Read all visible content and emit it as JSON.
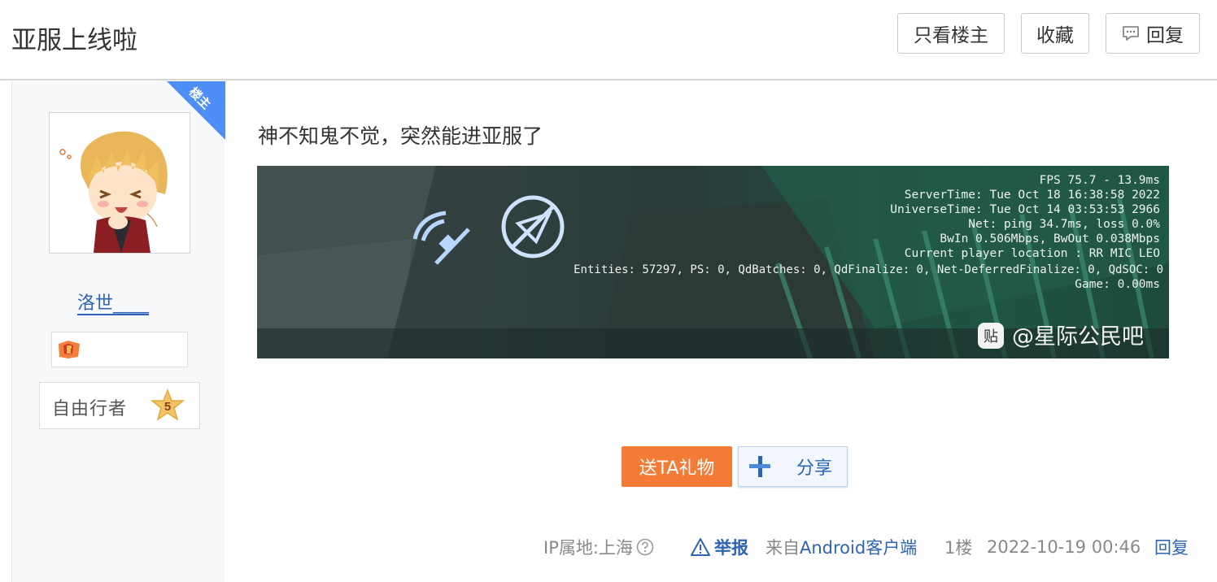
{
  "header": {
    "title": "亚服上线啦",
    "only_op_label": "只看楼主",
    "favorite_label": "收藏",
    "reply_label": "回复"
  },
  "author": {
    "op_tag": "楼主",
    "username": "洛世____",
    "level_name": "自由行者",
    "level_number": "5"
  },
  "post": {
    "text": "神不知鬼不觉，突然能进亚服了",
    "image": {
      "overlay_lines": [
        "FPS 75.7 - 13.9ms",
        "ServerTime: Tue Oct 18 16:38:58 2022",
        "UniverseTime: Tue Oct 14 03:53:53 2966",
        "Net: ping 34.7ms, loss 0.0%",
        "BwIn 0.506Mbps, BwOut 0.038Mbps",
        "Current player location : RR MIC LEO",
        "Entities: 57297, PS: 0, QdBatches: 0, QdFinalize: 0, Net-DeferredFinalize: 0, QdSOC: 0",
        "Game: 0.00ms"
      ],
      "watermark_badge": "贴",
      "watermark": "@星际公民吧"
    },
    "gift_label": "送TA礼物",
    "share_label": "分享"
  },
  "meta": {
    "ip_location": "IP属地:上海",
    "report_label": "举报",
    "from_prefix": "来自",
    "client": "Android客户端",
    "floor": "1楼",
    "time": "2022-10-19 00:46",
    "reply_label": "回复"
  },
  "colors": {
    "link_blue": "#2d64b3",
    "gift_orange": "#f47b36",
    "op_ribbon_blue": "#4e8ef7"
  },
  "icons": [
    "comment-icon",
    "level-star-icon",
    "team-badge-icon",
    "satellite-icon",
    "compass-emblem-icon",
    "share-plus-icon",
    "question-icon",
    "warning-icon"
  ]
}
